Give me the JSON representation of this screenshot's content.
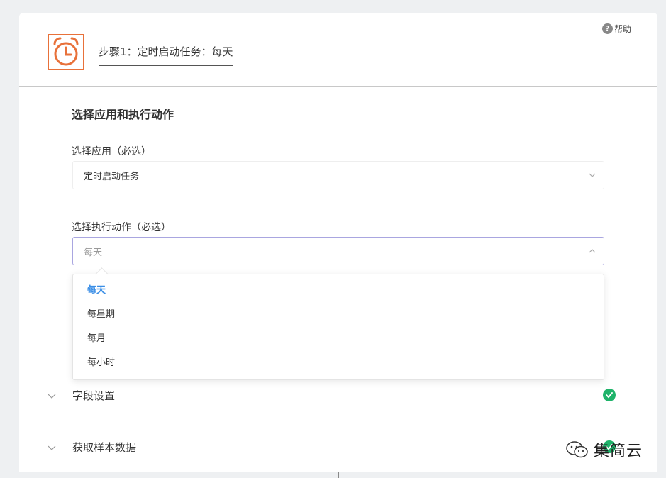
{
  "header": {
    "step_title": "步骤1：定时启动任务：每天",
    "help_label": "帮助",
    "help_glyph": "?"
  },
  "section": {
    "title": "选择应用和执行动作",
    "app_field": {
      "label": "选择应用（必选）",
      "value": "定时启动任务"
    },
    "action_field": {
      "label": "选择执行动作（必选）",
      "placeholder": "每天"
    }
  },
  "dropdown": {
    "options": [
      "每天",
      "每星期",
      "每月",
      "每小时"
    ],
    "selected": "每天"
  },
  "collapsed_sections": [
    {
      "label": "字段设置",
      "complete": true
    },
    {
      "label": "获取样本数据",
      "complete": true
    }
  ],
  "watermark": {
    "text": "集简云"
  },
  "colors": {
    "accent_orange": "#e8713a",
    "selected_blue": "#3a8ee6",
    "check_green": "#1fb36a",
    "focus_border": "#a9a6e0"
  }
}
